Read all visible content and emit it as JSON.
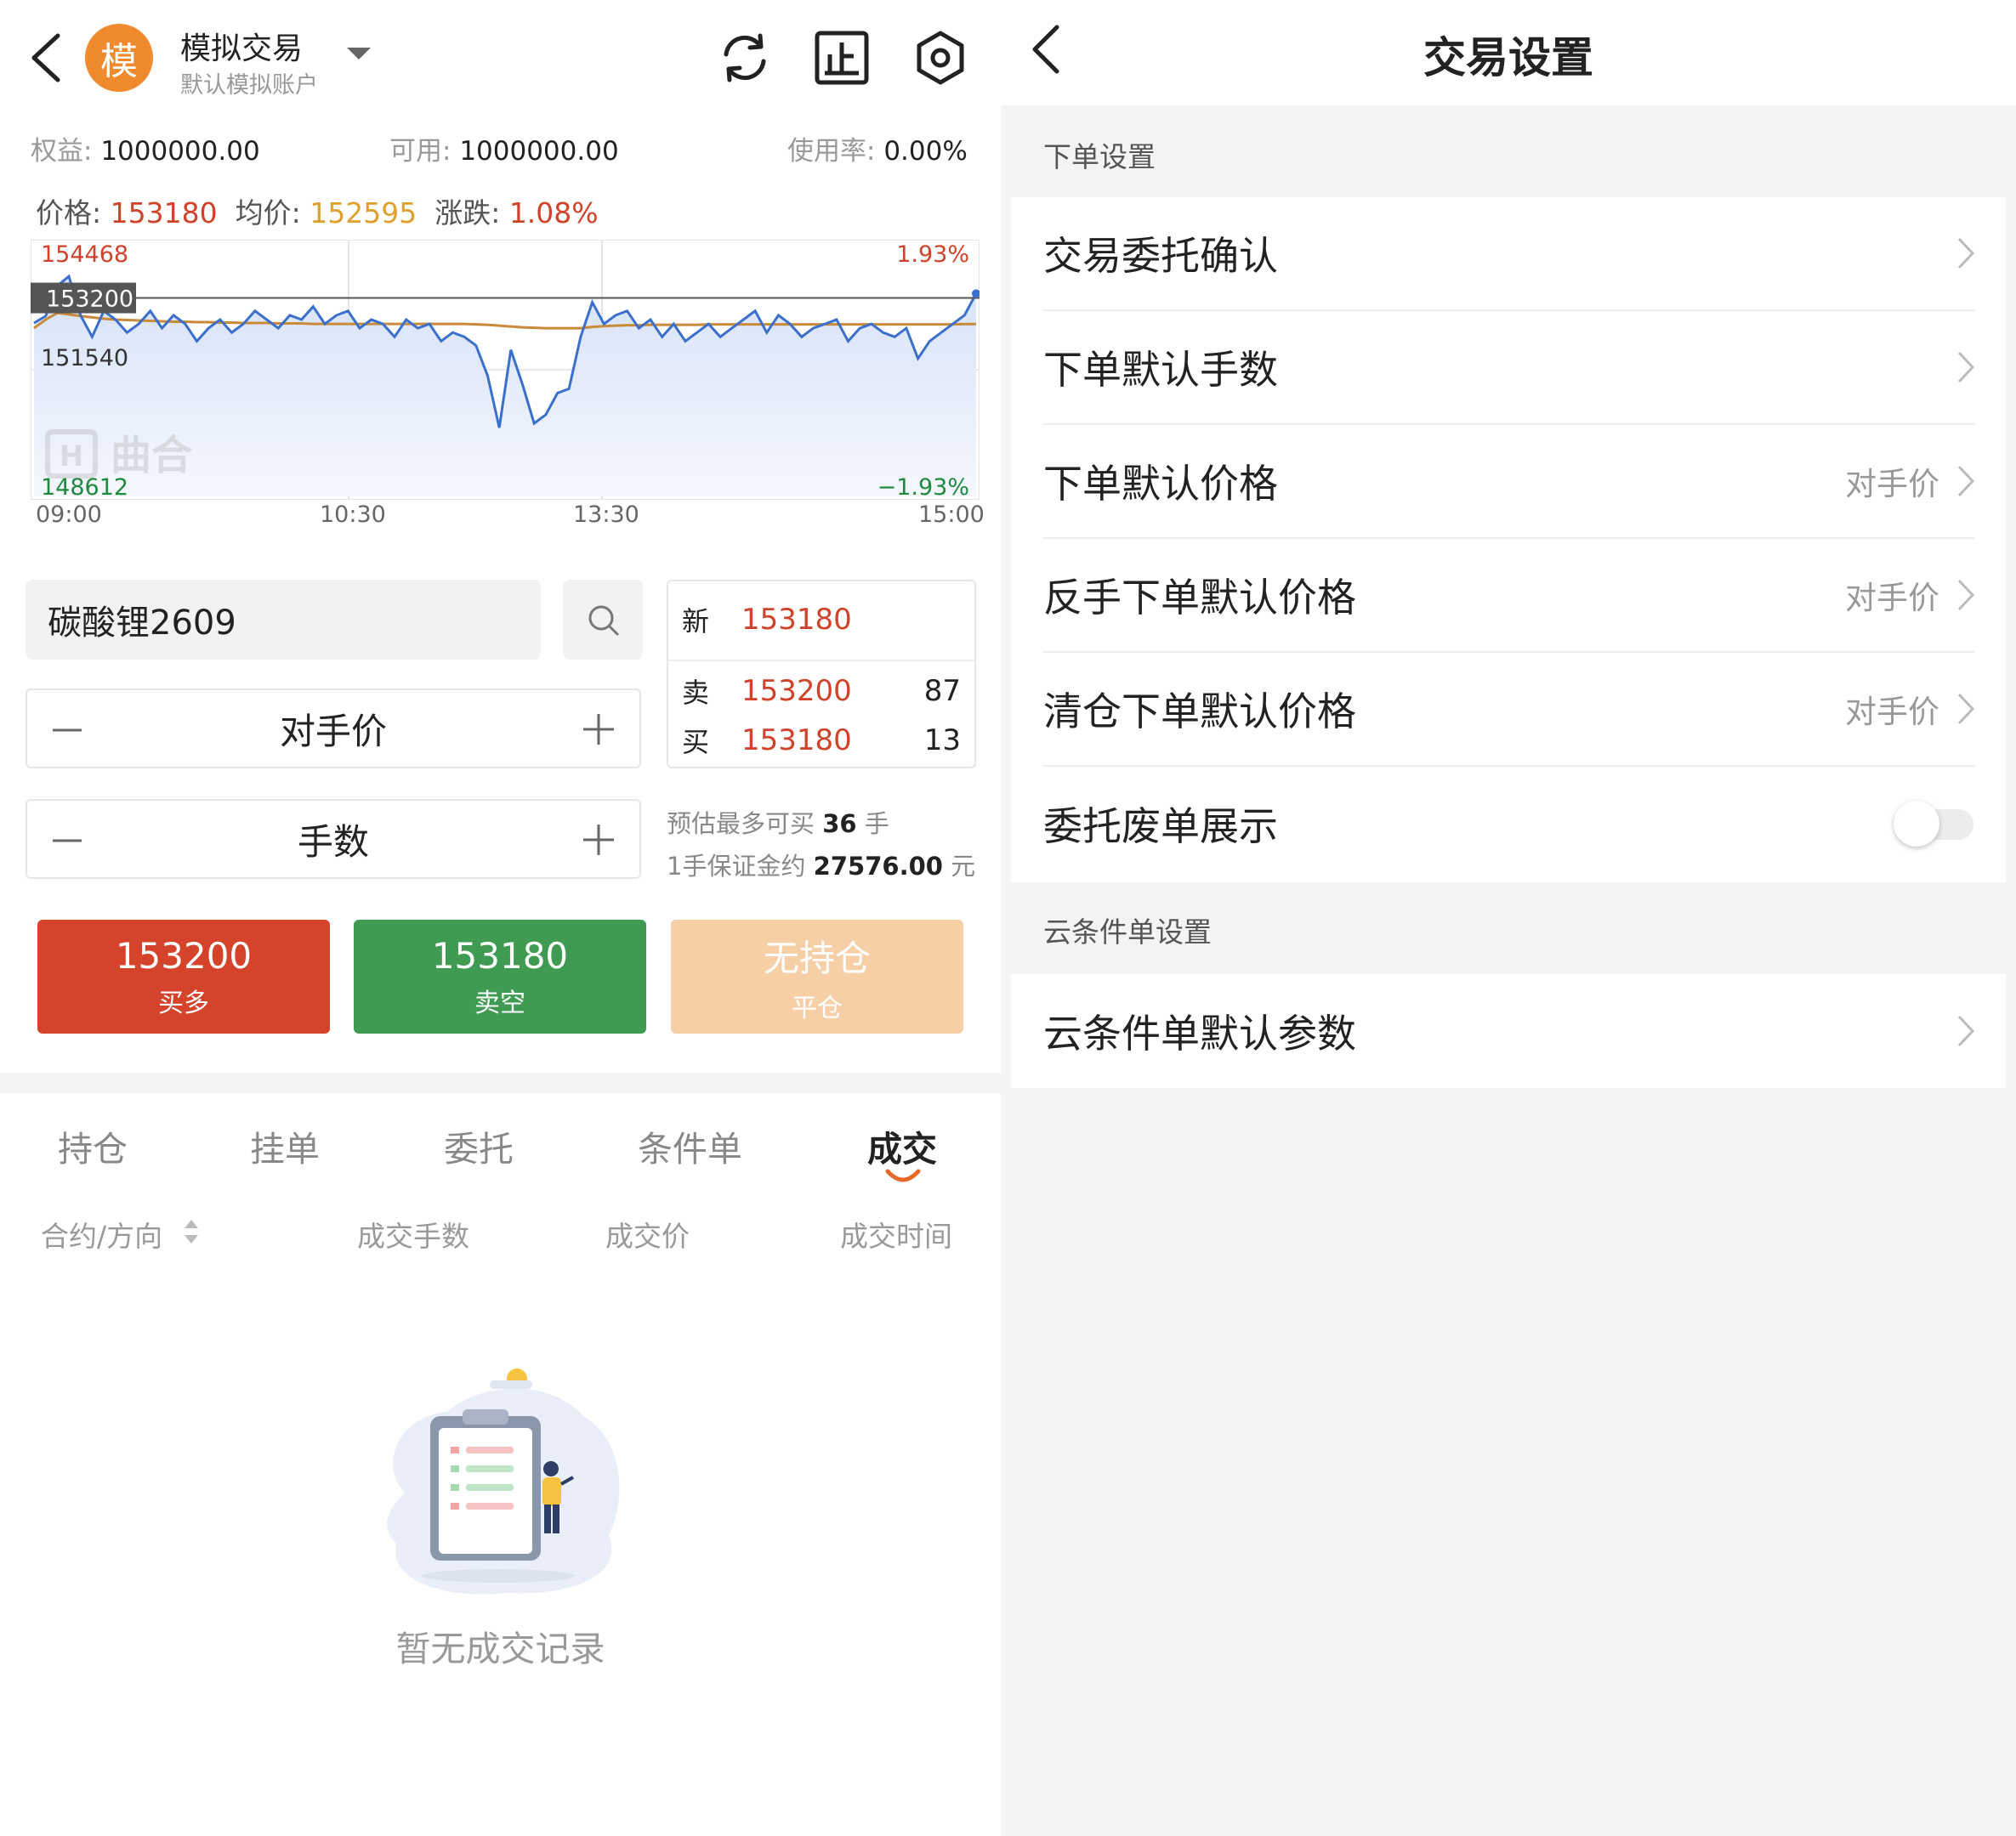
{
  "left": {
    "header": {
      "avatar_char": "模",
      "title": "模拟交易",
      "subtitle": "默认模拟账户"
    },
    "account": {
      "equity_label": "权益:",
      "equity": "1000000.00",
      "avail_label": "可用:",
      "avail": "1000000.00",
      "usage_label": "使用率:",
      "usage": "0.00%"
    },
    "price_line": {
      "price_label": "价格:",
      "price": "153180",
      "avg_label": "均价:",
      "avg": "152595",
      "change_label": "涨跌:",
      "change": "1.08%"
    },
    "chart_data": {
      "type": "line",
      "y_max_label": "154468",
      "y_mid_label": "151540",
      "y_min_label": "148612",
      "current_tag": "153200",
      "pct_max": "1.93%",
      "pct_min": "−1.93%",
      "x_ticks": [
        "09:00",
        "10:30",
        "13:30",
        "15:00"
      ],
      "ylim": [
        148612,
        154468
      ],
      "watermark": "曲合",
      "series": [
        {
          "role": "price",
          "color": "#3b6fcc",
          "values": [
            152620,
            152780,
            153480,
            153700,
            152800,
            152300,
            152900,
            152700,
            152400,
            152600,
            152900,
            152500,
            152800,
            152600,
            152200,
            152500,
            152700,
            152400,
            152600,
            152900,
            152700,
            152500,
            152800,
            152700,
            153000,
            152600,
            152800,
            152900,
            152500,
            152700,
            152600,
            152300,
            152700,
            152500,
            152600,
            152200,
            152400,
            152300,
            152100,
            151400,
            150200,
            152000,
            151200,
            150300,
            150500,
            151000,
            151100,
            152300,
            153100,
            152600,
            152800,
            152900,
            152500,
            152700,
            152300,
            152600,
            152200,
            152400,
            152600,
            152300,
            152500,
            152700,
            152900,
            152400,
            152800,
            152600,
            152300,
            152500,
            152600,
            152700,
            152200,
            152500,
            152600,
            152400,
            152300,
            152500,
            151800,
            152200,
            152400,
            152600,
            152800,
            153300
          ]
        },
        {
          "role": "avg",
          "color": "#c98a3a",
          "values": [
            152500,
            152700,
            152850,
            152820,
            152780,
            152750,
            152720,
            152700,
            152690,
            152680,
            152670,
            152660,
            152650,
            152650,
            152640,
            152640,
            152630,
            152630,
            152620,
            152620,
            152620,
            152610,
            152610,
            152610,
            152600,
            152600,
            152600,
            152600,
            152600,
            152600,
            152600,
            152600,
            152600,
            152600,
            152600,
            152600,
            152600,
            152600,
            152590,
            152580,
            152560,
            152540,
            152520,
            152510,
            152500,
            152500,
            152500,
            152500,
            152530,
            152550,
            152560,
            152570,
            152570,
            152580,
            152580,
            152580,
            152580,
            152580,
            152590,
            152590,
            152590,
            152590,
            152590,
            152590,
            152590,
            152590,
            152590,
            152590,
            152590,
            152590,
            152590,
            152590,
            152590,
            152590,
            152590,
            152590,
            152590,
            152590,
            152590,
            152590,
            152595,
            152595
          ]
        }
      ]
    },
    "order": {
      "symbol": "碳酸锂2609",
      "price_mode": "对手价",
      "lots_placeholder": "手数",
      "quote": {
        "new_label": "新",
        "new_price": "153180",
        "sell_label": "卖",
        "sell_price": "153200",
        "sell_vol": "87",
        "buy_label": "买",
        "buy_price": "153180",
        "buy_vol": "13"
      },
      "est_pre": "预估最多可买",
      "est_num": "36",
      "est_unit": "手",
      "margin_pre": "1手保证金约",
      "margin_num": "27576.00",
      "margin_unit": "元"
    },
    "buttons": {
      "buy": {
        "price": "153200",
        "label": "买多",
        "color": "#d4432a"
      },
      "sell": {
        "price": "153180",
        "label": "卖空",
        "color": "#3f9a52"
      },
      "close": {
        "price": "无持仓",
        "label": "平仓",
        "color": "#f7cfa6"
      }
    },
    "tabs": [
      "持仓",
      "挂单",
      "委托",
      "条件单",
      "成交"
    ],
    "active_tab": "成交",
    "columns": [
      "合约/方向",
      "成交手数",
      "成交价",
      "成交时间"
    ],
    "empty_text": "暂无成交记录"
  },
  "right": {
    "title": "交易设置",
    "section1_title": "下单设置",
    "section1_items": [
      {
        "label": "交易委托确认",
        "value": ""
      },
      {
        "label": "下单默认手数",
        "value": ""
      },
      {
        "label": "下单默认价格",
        "value": "对手价"
      },
      {
        "label": "反手下单默认价格",
        "value": "对手价"
      },
      {
        "label": "清仓下单默认价格",
        "value": "对手价"
      },
      {
        "label": "委托废单展示",
        "toggle": false
      }
    ],
    "section2_title": "云条件单设置",
    "section2_items": [
      {
        "label": "云条件单默认参数",
        "value": ""
      }
    ]
  }
}
